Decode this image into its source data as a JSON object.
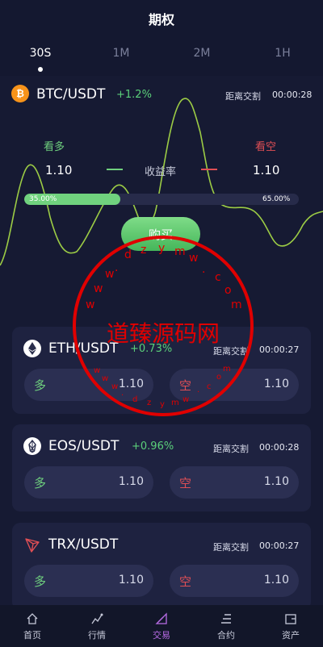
{
  "header": {
    "title": "期权"
  },
  "tabs": [
    {
      "label": "30S",
      "active": true
    },
    {
      "label": "1M",
      "active": false
    },
    {
      "label": "2M",
      "active": false
    },
    {
      "label": "1H",
      "active": false
    }
  ],
  "hero": {
    "pair": "BTC/USDT",
    "change": "+1.2%",
    "countdown_label": "距离交割",
    "countdown": "00:00:28",
    "long_label": "看多",
    "short_label": "看空",
    "long_rate": "1.10",
    "short_rate": "1.10",
    "rate_label": "收益率",
    "long_ratio_text": "35.00%",
    "short_ratio_text": "65.00%",
    "long_ratio": 0.35,
    "buy_label": "购买"
  },
  "cards": [
    {
      "pair": "ETH/USDT",
      "change": "+0.73%",
      "countdown_label": "距离交割",
      "countdown": "00:00:27",
      "long_side": "多",
      "short_side": "空",
      "long_rate": "1.10",
      "short_rate": "1.10",
      "icon": "ethereum-icon"
    },
    {
      "pair": "EOS/USDT",
      "change": "+0.96%",
      "countdown_label": "距离交割",
      "countdown": "00:00:28",
      "long_side": "多",
      "short_side": "空",
      "long_rate": "1.10",
      "short_rate": "1.10",
      "icon": "eos-icon"
    },
    {
      "pair": "TRX/USDT",
      "change": "",
      "countdown_label": "距离交割",
      "countdown": "00:00:27",
      "long_side": "多",
      "short_side": "空",
      "long_rate": "1.10",
      "short_rate": "1.10",
      "icon": "tron-icon"
    }
  ],
  "nav": [
    {
      "label": "首页",
      "icon": "home-icon",
      "active": false
    },
    {
      "label": "行情",
      "icon": "market-icon",
      "active": false
    },
    {
      "label": "交易",
      "icon": "trade-icon",
      "active": true
    },
    {
      "label": "合约",
      "icon": "contract-icon",
      "active": false
    },
    {
      "label": "资产",
      "icon": "wallet-icon",
      "active": false
    }
  ],
  "watermark": {
    "main_text": "道臻源码网",
    "ring_text": "www.dzym.com"
  },
  "colors": {
    "accent_green": "#70d27e",
    "accent_red": "#e04f55",
    "nav_active": "#b86ce6",
    "background": "#161a33",
    "card": "#1e2240"
  }
}
